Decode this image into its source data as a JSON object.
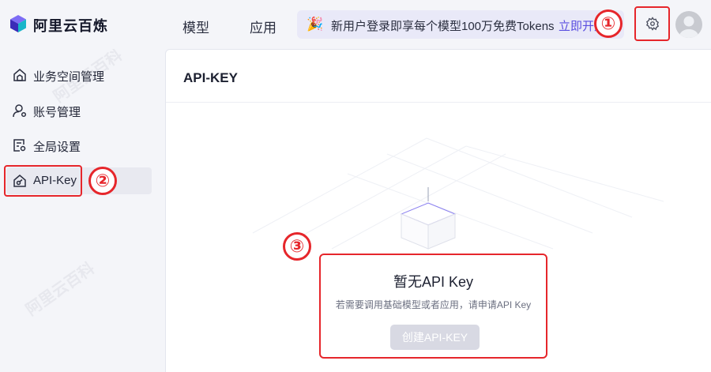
{
  "header": {
    "brand": "阿里云百炼",
    "nav": [
      {
        "label": "模型"
      },
      {
        "label": "应用"
      }
    ],
    "promo": {
      "icon": "party-popper-icon",
      "text": "新用户登录即享每个模型100万免费Tokens",
      "link": "立即开通"
    },
    "settings_icon": "gear-icon",
    "avatar_icon": "user-avatar-icon"
  },
  "sidebar": {
    "items": [
      {
        "label": "业务空间管理",
        "icon": "house-icon"
      },
      {
        "label": "账号管理",
        "icon": "user-icon"
      },
      {
        "label": "全局设置",
        "icon": "settings-doc-icon"
      },
      {
        "label": "API-Key",
        "icon": "key-house-icon",
        "active": true
      }
    ]
  },
  "main": {
    "title": "API-KEY",
    "empty": {
      "title": "暂无API Key",
      "description": "若需要调用基础模型或者应用，请申请API Key",
      "button": "创建API-KEY"
    }
  },
  "markers": [
    "①",
    "②",
    "③"
  ],
  "watermark": "阿里云百科",
  "colors": {
    "accent": "#5a4ee0",
    "highlight": "#e6262b",
    "disabled_button": "#d8d9e3"
  }
}
